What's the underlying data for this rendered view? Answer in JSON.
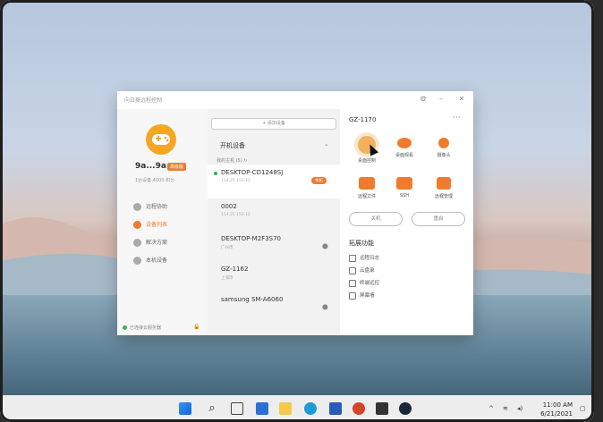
{
  "window": {
    "title": "向日葵远程控制"
  },
  "sidebar": {
    "username": "9a...9a",
    "badge": "高级版",
    "stats": "1台设备    4000    积分",
    "items": [
      {
        "label": "远程协助",
        "active": false
      },
      {
        "label": "设备列表",
        "active": true
      },
      {
        "label": "解决方案",
        "active": false
      },
      {
        "label": "本机设备",
        "active": false
      }
    ],
    "footer": "已连接云服务器",
    "footer_status_color": "#2fb54a"
  },
  "device_panel": {
    "add_button": "+ 添加设备",
    "selector": "开机设备",
    "group": "我的主机 (5)",
    "devices": [
      {
        "name": "DESKTOP-CD1248SJ",
        "sub": "114.25 153.12",
        "active": true,
        "online": true,
        "badge": "本机",
        "os_icon": ""
      },
      {
        "name": "0002",
        "sub": "114.25 153.12",
        "active": false,
        "online": false,
        "badge": "",
        "os_icon": "apple-icon"
      },
      {
        "name": "DESKTOP-M2F3S70",
        "sub": "广州市",
        "active": false,
        "online": false,
        "badge": "",
        "os_icon": "android-icon"
      },
      {
        "name": "GZ-1162",
        "sub": "上海市",
        "active": false,
        "online": false,
        "badge": "",
        "os_icon": "apple-icon"
      },
      {
        "name": "samsung SM-A6060",
        "sub": "",
        "active": false,
        "online": false,
        "badge": "",
        "os_icon": "android-icon"
      }
    ]
  },
  "detail": {
    "title": "GZ-1170",
    "more": "···",
    "actions": [
      "桌面控制",
      "桌面观看",
      "摄像头",
      "远程文件",
      "SSH",
      "远程管理"
    ],
    "buttons": [
      "关机",
      "重启"
    ],
    "extensions_title": "拓展功能",
    "extensions": [
      "远程日志",
      "云盘录",
      "终端远控",
      "屏幕墙"
    ],
    "accent_color": "#f07b2e"
  },
  "taskbar": {
    "time": "11:00 AM",
    "date": "6/21/2021",
    "search_glyph": "⌕"
  }
}
